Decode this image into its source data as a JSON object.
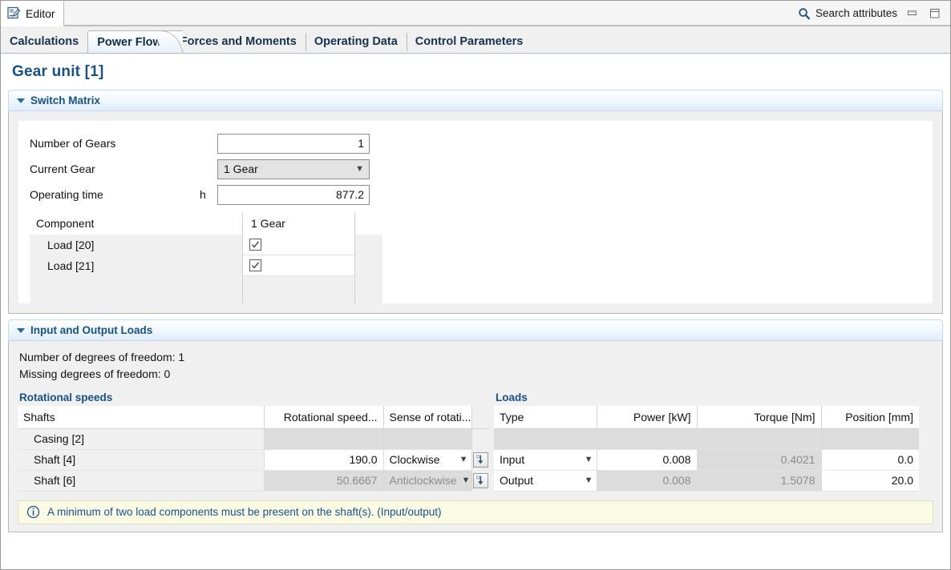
{
  "window": {
    "editor_tab_label": "Editor",
    "editor_icon": "editor-document-pencil-icon",
    "search_label": "Search attributes",
    "search_icon": "search-icon",
    "minimize_icon": "minimize-icon",
    "maximize_icon": "maximize-icon"
  },
  "tabs": [
    {
      "label": "Calculations",
      "active": false
    },
    {
      "label": "Power Flow",
      "active": true
    },
    {
      "label": "Forces and Moments",
      "active": false
    },
    {
      "label": "Operating Data",
      "active": false
    },
    {
      "label": "Control Parameters",
      "active": false
    }
  ],
  "page": {
    "title": "Gear unit [1]"
  },
  "switch_matrix": {
    "section_title": "Switch Matrix",
    "fields": {
      "number_of_gears_label": "Number of Gears",
      "number_of_gears_value": "1",
      "current_gear_label": "Current Gear",
      "current_gear_value": "1 Gear",
      "operating_time_label": "Operating time",
      "operating_time_unit": "h",
      "operating_time_value": "877.2"
    },
    "table": {
      "headers": [
        "Component",
        "1 Gear"
      ],
      "rows": [
        {
          "component": "Load [20]",
          "checked": true
        },
        {
          "component": "Load [21]",
          "checked": true
        }
      ]
    }
  },
  "input_output_loads": {
    "section_title": "Input and Output Loads",
    "degrees_of_freedom": "Number of degrees of freedom: 1",
    "missing_degrees_of_freedom": "Missing degrees of freedom: 0",
    "rotational_speeds": {
      "caption": "Rotational speeds",
      "headers": [
        "Shafts",
        "Rotational speed...",
        "Sense of rotati..."
      ],
      "rows": [
        {
          "shaft": "Casing [2]",
          "speed": "",
          "sense": "",
          "speed_disabled": true,
          "sense_disabled": true,
          "has_button": false
        },
        {
          "shaft": "Shaft [4]",
          "speed": "190.0",
          "sense": "Clockwise",
          "speed_disabled": false,
          "sense_disabled": false,
          "has_button": true
        },
        {
          "shaft": "Shaft [6]",
          "speed": "50.6667",
          "sense": "Anticlockwise",
          "speed_disabled": true,
          "sense_disabled": true,
          "has_button": true
        }
      ],
      "row_button_icon": "insert-down-arrow-icon"
    },
    "loads": {
      "caption": "Loads",
      "headers": [
        "Type",
        "Power [kW]",
        "Torque [Nm]",
        "Position [mm]"
      ],
      "rows": [
        {
          "type": "",
          "power": "",
          "torque": "",
          "position": "",
          "blank": true
        },
        {
          "type": "Input",
          "power": "0.008",
          "torque": "0.4021",
          "position": "0.0",
          "power_disabled": false,
          "torque_disabled": true,
          "position_disabled": false
        },
        {
          "type": "Output",
          "power": "0.008",
          "torque": "1.5078",
          "position": "20.0",
          "power_disabled": true,
          "torque_disabled": true,
          "position_disabled": false
        }
      ]
    },
    "info": {
      "icon": "info-icon",
      "message": "A minimum of two load components must be present on the shaft(s). (Input/output)"
    }
  },
  "colors": {
    "accent_blue": "#16518c",
    "header_gradient_top": "#ffffff",
    "header_gradient_bottom": "#dfecf9",
    "info_bg": "#fbfbe4",
    "disabled_cell": "#dcdcdc",
    "icon_blue": "#2f5f93"
  }
}
